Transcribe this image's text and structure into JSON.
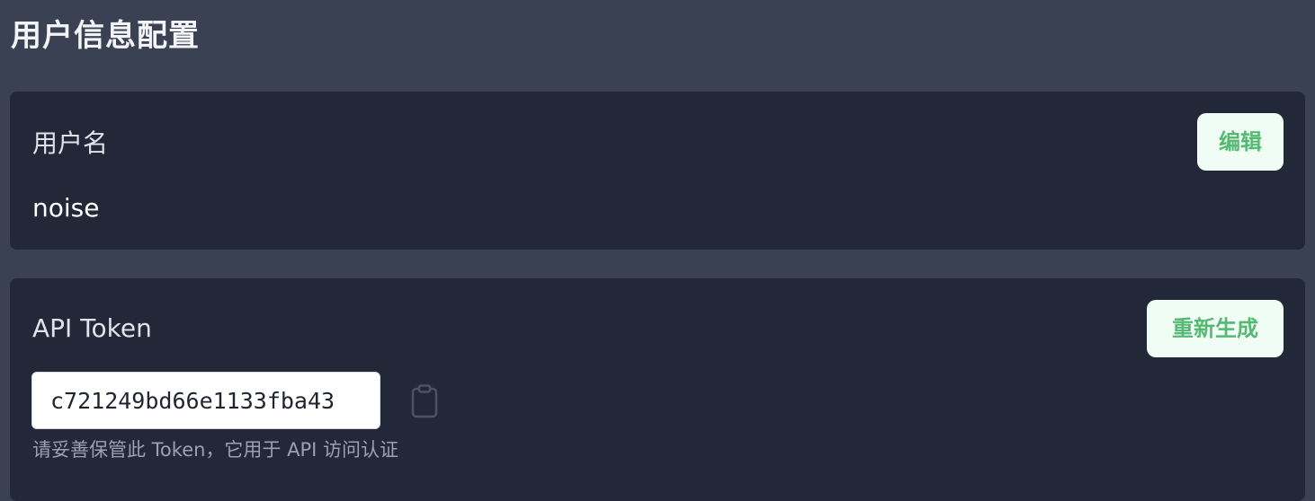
{
  "page": {
    "title": "用户信息配置"
  },
  "username_card": {
    "label": "用户名",
    "value": "noise",
    "edit_label": "编辑"
  },
  "token_card": {
    "label": "API Token",
    "regenerate_label": "重新生成",
    "token_value": "c721249bd66e1133fba43",
    "hint": "请妥善保管此 Token，它用于 API 访问认证",
    "copy_icon": "clipboard-icon"
  },
  "colors": {
    "page_background": "#3a4152",
    "card_background": "#222837",
    "button_background": "#f0fdf4",
    "button_text": "#57b874"
  }
}
